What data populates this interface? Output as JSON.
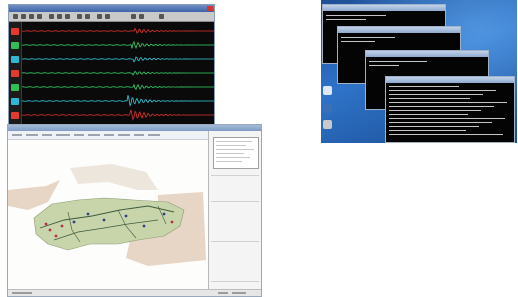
{
  "screenshots": [
    {
      "id": "seismic-viewer",
      "description_kind": "waveform-display"
    },
    {
      "id": "map-app",
      "description_kind": "gis-map"
    },
    {
      "id": "console-windows",
      "description_kind": "command-prompts"
    }
  ],
  "colors": {
    "trace_green": "#36d46a",
    "trace_cyan": "#34d0e0",
    "trace_red": "#e0332d",
    "channel_tags": [
      "#e23a2f",
      "#2fbf54",
      "#2fb7d6",
      "#e23a2f",
      "#2fbf54",
      "#2fb7d6",
      "#e23a2f"
    ],
    "land": "#c8d4a9",
    "neighbor": "#e7d5c6",
    "desktop": "#2e73c8"
  },
  "icons": [
    "window-close-icon",
    "toolbar-icon",
    "desktop-app-icon"
  ]
}
